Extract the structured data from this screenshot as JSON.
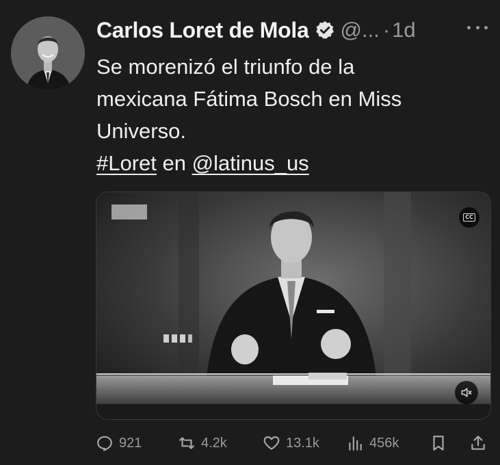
{
  "post": {
    "author_name": "Carlos Loret de Mola",
    "handle": "@...",
    "separator": "·",
    "time": "1d",
    "text_lines": [
      "Se morenizó el triunfo de la",
      "mexicana Fátima Bosch en Miss",
      "Universo."
    ],
    "hashtag": "#Loret",
    "connector": " en ",
    "mention": "@latinus_us"
  },
  "media": {
    "type": "video",
    "cc_label": "CC"
  },
  "actions": {
    "replies": "921",
    "reposts": "4.2k",
    "likes": "13.1k",
    "views": "456k"
  },
  "icons": {
    "verified": "verified-badge-icon",
    "more": "more-horizontal-icon",
    "reply": "reply-bubble-icon",
    "repost": "repost-icon",
    "like": "heart-icon",
    "views": "views-bar-chart-icon",
    "bookmark": "bookmark-icon",
    "share": "share-upload-icon",
    "captions": "closed-captions-icon",
    "sound": "speaker-icon"
  },
  "colors": {
    "background": "#1c1c1c",
    "text": "#efefef",
    "muted": "#9a9a9a"
  }
}
